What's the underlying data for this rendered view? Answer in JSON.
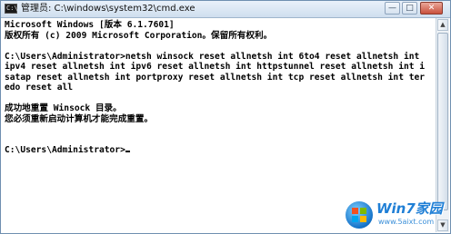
{
  "window": {
    "title": "管理员: C:\\windows\\system32\\cmd.exe",
    "app_icon_text": "C:\\",
    "controls": {
      "minimize": "—",
      "maximize": "□",
      "close": "✕"
    }
  },
  "console": {
    "lines": [
      "Microsoft Windows [版本 6.1.7601]",
      "版权所有 (c) 2009 Microsoft Corporation。保留所有权利。",
      "",
      "C:\\Users\\Administrator>netsh winsock reset allnetsh int 6to4 reset allnetsh int",
      "ipv4 reset allnetsh int ipv6 reset allnetsh int httpstunnel reset allnetsh int i",
      "satap reset allnetsh int portproxy reset allnetsh int tcp reset allnetsh int ter",
      "edo reset all",
      "",
      "成功地重置 Winsock 目录。",
      "您必须重新启动计算机才能完成重置。",
      "",
      "",
      "C:\\Users\\Administrator>"
    ]
  },
  "watermark": {
    "brand": "Win7家园",
    "url": "www.5aixt.com"
  }
}
